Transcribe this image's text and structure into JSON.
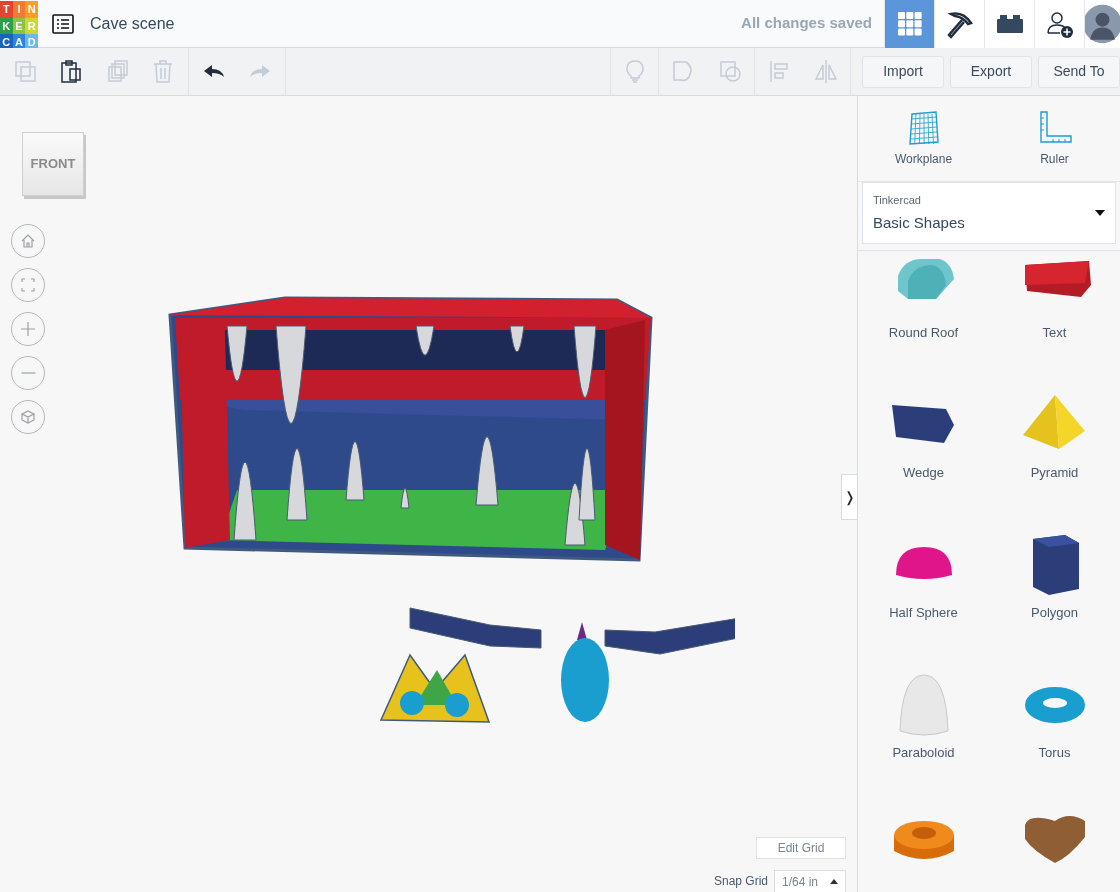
{
  "logo": {
    "letters": [
      "T",
      "I",
      "N",
      "K",
      "E",
      "R",
      "C",
      "A",
      "D"
    ]
  },
  "header": {
    "title": "Cave scene",
    "save_status": "All changes saved",
    "nav": [
      {
        "kind": "grid",
        "selected": true
      },
      {
        "kind": "pickaxe",
        "selected": false
      },
      {
        "kind": "brick",
        "selected": false
      },
      {
        "kind": "invite",
        "selected": false
      },
      {
        "kind": "avatar",
        "selected": false
      }
    ]
  },
  "toolbar": {
    "edit_tools": [
      {
        "kind": "copy",
        "disabled": true
      },
      {
        "kind": "paste",
        "disabled": false
      },
      {
        "kind": "duplicate",
        "disabled": true
      },
      {
        "kind": "delete",
        "disabled": true
      },
      {
        "kind": "undo",
        "disabled": false
      },
      {
        "kind": "redo",
        "disabled": true
      }
    ],
    "shape_tools": [
      {
        "kind": "light",
        "disabled": true
      },
      {
        "kind": "group",
        "disabled": true
      },
      {
        "kind": "ungroup",
        "disabled": true
      },
      {
        "kind": "align",
        "disabled": true
      },
      {
        "kind": "mirror",
        "disabled": true
      }
    ],
    "buttons": [
      "Import",
      "Export",
      "Send To"
    ]
  },
  "view_cube": {
    "label": "FRONT"
  },
  "view_controls": [
    {
      "kind": "home"
    },
    {
      "kind": "fit"
    },
    {
      "kind": "zoom-in"
    },
    {
      "kind": "zoom-out"
    },
    {
      "kind": "perspective"
    }
  ],
  "grid": {
    "edit_button": "Edit Grid",
    "snap_label": "Snap Grid",
    "snap_value": "1/64 in"
  },
  "panel": {
    "tools": [
      {
        "kind": "workplane",
        "label": "Workplane"
      },
      {
        "kind": "ruler",
        "label": "Ruler"
      }
    ],
    "library": {
      "source": "Tinkercad",
      "category": "Basic Shapes"
    },
    "shapes": [
      {
        "kind": "roof",
        "label": "Round Roof"
      },
      {
        "kind": "text",
        "label": "Text"
      },
      {
        "kind": "wedge",
        "label": "Wedge"
      },
      {
        "kind": "pyramid",
        "label": "Pyramid"
      },
      {
        "kind": "halfsphere",
        "label": "Half Sphere"
      },
      {
        "kind": "polygon",
        "label": "Polygon"
      },
      {
        "kind": "paraboloid",
        "label": "Paraboloid"
      },
      {
        "kind": "torus",
        "label": "Torus"
      },
      {
        "kind": "tube"
      },
      {
        "kind": "heart"
      }
    ],
    "collapse": "❭"
  }
}
